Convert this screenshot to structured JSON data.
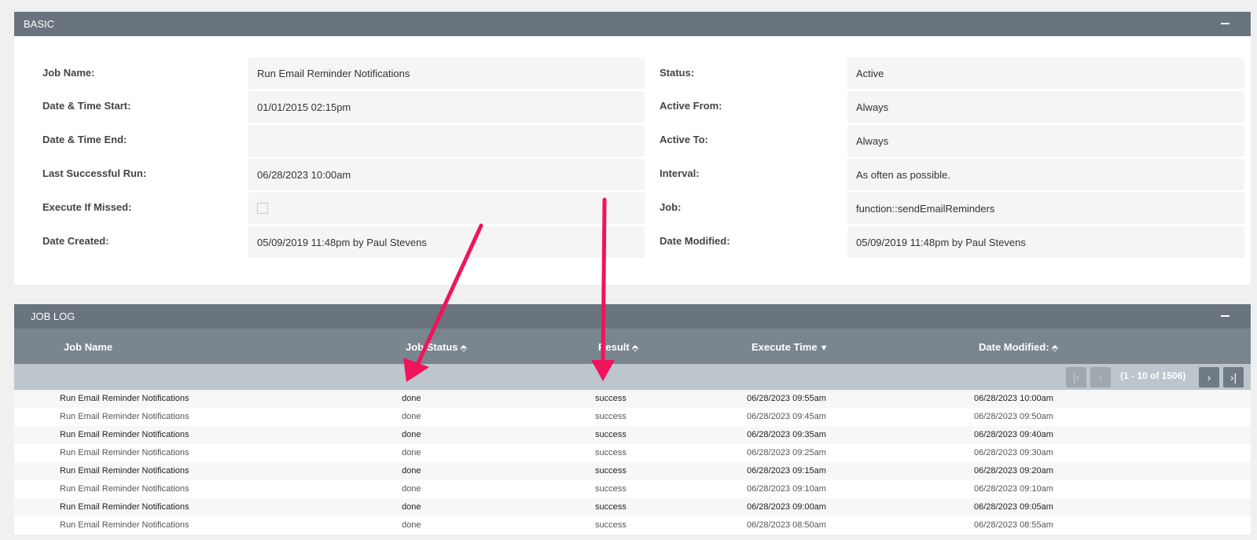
{
  "basic": {
    "title": "BASIC",
    "fields_left": [
      {
        "label": "Job Name:",
        "value": "Run Email Reminder Notifications"
      },
      {
        "label": "Date & Time Start:",
        "value": "01/01/2015 02:15pm"
      },
      {
        "label": "Date & Time End:",
        "value": ""
      },
      {
        "label": "Last Successful Run:",
        "value": "06/28/2023 10:00am"
      },
      {
        "label": "Execute If Missed:",
        "value": ""
      },
      {
        "label": "Date Created:",
        "value": "05/09/2019 11:48pm by Paul Stevens"
      }
    ],
    "fields_right": [
      {
        "label": "Status:",
        "value": "Active"
      },
      {
        "label": "Active From:",
        "value": "Always"
      },
      {
        "label": "Active To:",
        "value": "Always"
      },
      {
        "label": "Interval:",
        "value": "As often as possible."
      },
      {
        "label": "Job:",
        "value": "function::sendEmailReminders"
      },
      {
        "label": "Date Modified:",
        "value": "05/09/2019 11:48pm by Paul Stevens"
      }
    ]
  },
  "joblog": {
    "title": "JOB LOG",
    "columns": [
      "Job Name",
      "Job Status",
      "Result",
      "Execute Time",
      "Date Modified:"
    ],
    "pager_text": "(1 - 10 of 1506)",
    "rows": [
      [
        "Run Email Reminder Notifications",
        "done",
        "success",
        "06/28/2023 09:55am",
        "06/28/2023 10:00am"
      ],
      [
        "Run Email Reminder Notifications",
        "done",
        "success",
        "06/28/2023 09:45am",
        "06/28/2023 09:50am"
      ],
      [
        "Run Email Reminder Notifications",
        "done",
        "success",
        "06/28/2023 09:35am",
        "06/28/2023 09:40am"
      ],
      [
        "Run Email Reminder Notifications",
        "done",
        "success",
        "06/28/2023 09:25am",
        "06/28/2023 09:30am"
      ],
      [
        "Run Email Reminder Notifications",
        "done",
        "success",
        "06/28/2023 09:15am",
        "06/28/2023 09:20am"
      ],
      [
        "Run Email Reminder Notifications",
        "done",
        "success",
        "06/28/2023 09:10am",
        "06/28/2023 09:10am"
      ],
      [
        "Run Email Reminder Notifications",
        "done",
        "success",
        "06/28/2023 09:00am",
        "06/28/2023 09:05am"
      ],
      [
        "Run Email Reminder Notifications",
        "done",
        "success",
        "06/28/2023 08:50am",
        "06/28/2023 08:55am"
      ]
    ]
  },
  "icons": {
    "collapse": "minus-icon",
    "sort": "sort-icon",
    "first": "first-page-icon",
    "prev": "prev-page-icon",
    "next": "next-page-icon",
    "last": "last-page-icon",
    "annotation": "arrow-annotation"
  },
  "colors": {
    "header_bg": "#69747f",
    "column_header_bg": "#79858f",
    "pager_bg": "#bdc6cc",
    "arrow": "#f0145a"
  }
}
